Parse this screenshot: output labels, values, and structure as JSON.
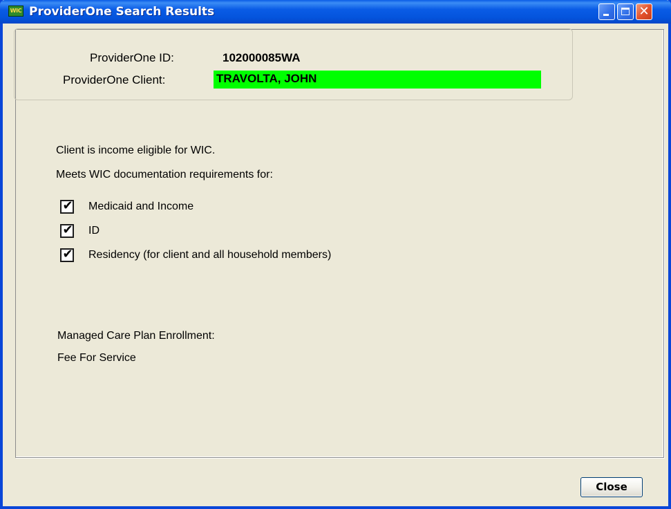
{
  "window": {
    "title": "ProviderOne Search Results",
    "icon_label": "WIC",
    "icon": "wic-app-icon",
    "controls": {
      "minimize_icon": "minimize-icon",
      "maximize_icon": "maximize-icon",
      "close_icon": "close-icon",
      "close_glyph": "✕"
    }
  },
  "provider": {
    "id_label": "ProviderOne ID:",
    "id_value": "102000085WA",
    "client_label": "ProviderOne Client:",
    "client_value": "TRAVOLTA, JOHN",
    "client_highlight_color": "#00ff00"
  },
  "eligibility": {
    "income_text": "Client is income eligible for WIC.",
    "documentation_text": "Meets WIC documentation requirements for:",
    "checklist": [
      {
        "label": "Medicaid and Income",
        "checked": true
      },
      {
        "label": "ID",
        "checked": true
      },
      {
        "label": "Residency (for client and all household members)",
        "checked": true
      }
    ],
    "check_glyph": "✔"
  },
  "managed_care": {
    "label": "Managed Care Plan Enrollment:",
    "value": "Fee For Service"
  },
  "buttons": {
    "close_label": "Close"
  },
  "colors": {
    "title_bar": "#0a5ce6",
    "background": "#ece9d8",
    "highlight": "#00ff00"
  }
}
